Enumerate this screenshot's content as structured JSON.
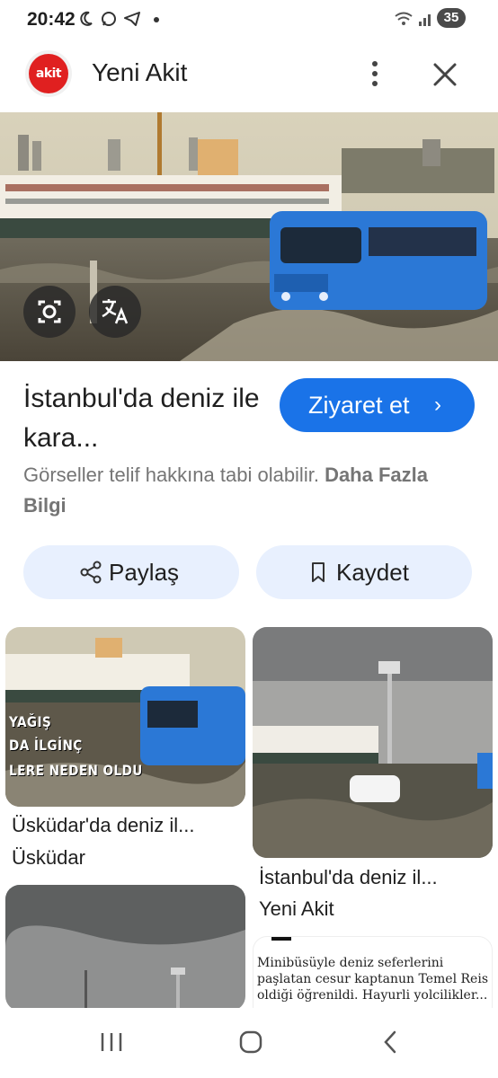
{
  "status_bar": {
    "time": "20:42",
    "battery": "35",
    "left_icons": [
      "moon-icon",
      "whatsapp-icon",
      "telegram-icon",
      "dot-icon"
    ],
    "right_icons": [
      "wifi-icon",
      "signal-icon"
    ]
  },
  "header": {
    "logo_text": "akit",
    "title": "Yeni Akit",
    "brand_color": "#e02020"
  },
  "result": {
    "title": "İstanbul'da deniz ile kara...",
    "visit_label": "Ziyaret et",
    "copyright_text": "Görseller telif hakkına tabi olabilir.",
    "learn_more": "Daha Fazla Bilgi",
    "accent_color": "#1a73e8"
  },
  "actions": {
    "share_label": "Paylaş",
    "save_label": "Kaydet"
  },
  "related": [
    {
      "title": "Üsküdar'da deniz il...",
      "source": "Üsküdar",
      "overlay_lines": [
        "YAĞIŞ",
        "DA İLGİNÇ",
        "LERE NEDEN OLDU"
      ]
    },
    {
      "title": "İstanbul'da deniz il...",
      "source": "Yeni Akit"
    },
    {
      "caption": "Minibüsüyle deniz seferlerini paşlatan cesur kaptanun Temel Reis oldiği öğrenildi. Hayurli yolcilikler..."
    }
  ],
  "nav": [
    "recent-apps-icon",
    "home-icon",
    "back-icon"
  ]
}
